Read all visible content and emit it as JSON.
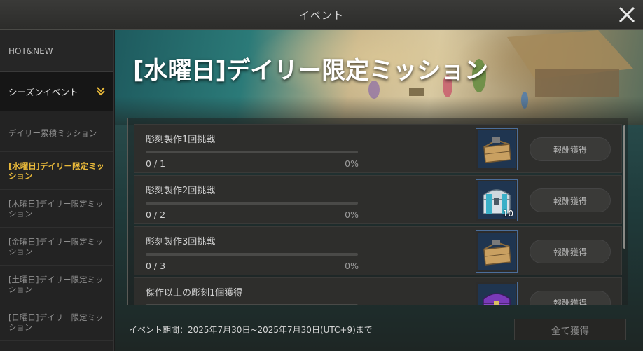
{
  "window": {
    "title": "イベント"
  },
  "sidebar": {
    "hot_new": "HOT&NEW",
    "season_event": "シーズンイベント",
    "items": [
      {
        "label": "デイリー累積ミッション",
        "active": false
      },
      {
        "label": "[水曜日]デイリー限定ミッション",
        "active": true
      },
      {
        "label": "[木曜日]デイリー限定ミッション",
        "active": false
      },
      {
        "label": "[金曜日]デイリー限定ミッション",
        "active": false
      },
      {
        "label": "[土曜日]デイリー限定ミッション",
        "active": false
      },
      {
        "label": "[日曜日]デイリー限定ミッション",
        "active": false
      }
    ]
  },
  "main": {
    "event_title": "[水曜日]デイリー限定ミッション",
    "missions": [
      {
        "name": "彫刻製作1回挑戦",
        "count": "0 / 1",
        "percent": "0%",
        "progress": 0,
        "reward_icon": "wooden-toolbox-icon",
        "reward_qty": "",
        "button": "報酬獲得"
      },
      {
        "name": "彫刻製作2回挑戦",
        "count": "0 / 2",
        "percent": "0%",
        "progress": 0,
        "reward_icon": "silver-chest-icon",
        "reward_qty": "10",
        "button": "報酬獲得"
      },
      {
        "name": "彫刻製作3回挑戦",
        "count": "0 / 3",
        "percent": "0%",
        "progress": 0,
        "reward_icon": "wooden-toolbox-icon",
        "reward_qty": "",
        "button": "報酬獲得"
      },
      {
        "name": "傑作以上の彫刻1個獲得",
        "count": "",
        "percent": "",
        "progress": 0,
        "reward_icon": "purple-chest-icon",
        "reward_qty": "",
        "button": "報酬獲得"
      }
    ],
    "event_period": "イベント期間：2025年7月30日~2025年7月30日(UTC+9)まで",
    "claim_all": "全て獲得"
  },
  "colors": {
    "accent": "#e9b93a",
    "panel": "#2e2e2c"
  }
}
